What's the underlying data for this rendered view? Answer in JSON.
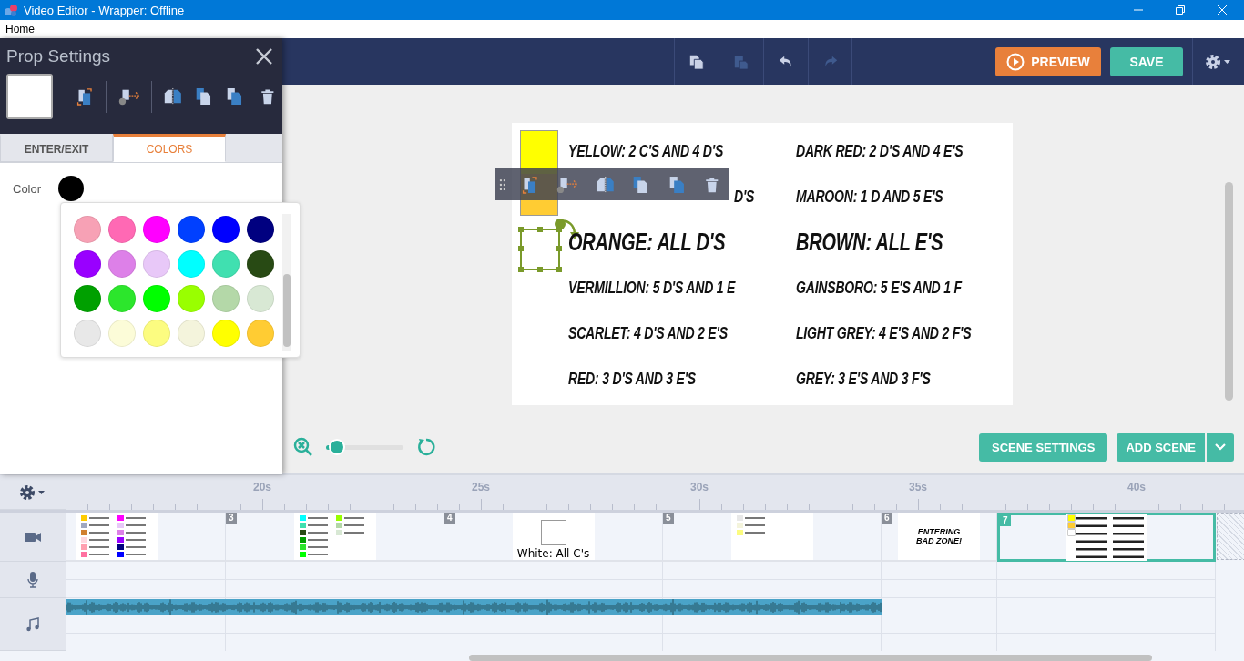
{
  "window": {
    "title": "Video Editor - Wrapper: Offline"
  },
  "menu": [
    "Home"
  ],
  "toolbar": {
    "tools": [
      {
        "kind": "copy",
        "disabled": false
      },
      {
        "kind": "paste",
        "disabled": true
      },
      {
        "kind": "undo",
        "disabled": false
      },
      {
        "kind": "redo",
        "disabled": true
      }
    ],
    "preview": "PREVIEW",
    "save": "SAVE"
  },
  "prop_settings": {
    "title": "Prop Settings",
    "tabs": [
      {
        "label": "ENTER/EXIT",
        "selected": false
      },
      {
        "label": "COLORS",
        "selected": true
      }
    ],
    "color_label": "Color",
    "current": {
      "color": "#000000"
    },
    "palette": [
      {
        "color": "#f7a1b5"
      },
      {
        "color": "#ff69b4"
      },
      {
        "color": "#ff00ff"
      },
      {
        "color": "#0040ff"
      },
      {
        "color": "#0000ff"
      },
      {
        "color": "#000080"
      },
      {
        "color": "#9900ff"
      },
      {
        "color": "#dd80e8"
      },
      {
        "color": "#e8c8f8"
      },
      {
        "color": "#00ffff"
      },
      {
        "color": "#40e0b0"
      },
      {
        "color": "#284a14"
      },
      {
        "color": "#00a000"
      },
      {
        "color": "#2ce62c"
      },
      {
        "color": "#00ff00"
      },
      {
        "color": "#99ff00"
      },
      {
        "color": "#b4d8a8"
      },
      {
        "color": "#d8e8d4"
      },
      {
        "color": "#e8e8e8"
      },
      {
        "color": "#fcfcd8"
      },
      {
        "color": "#fcfc80"
      },
      {
        "color": "#f4f4dc"
      },
      {
        "color": "#ffff00"
      },
      {
        "color": "#ffcc33"
      }
    ]
  },
  "canvas": {
    "swatches": [
      {
        "color": "#ffff00",
        "selected": false
      },
      {
        "color": "#ffcc33",
        "selected": false
      },
      {
        "color": "#ffffff",
        "selected": true
      }
    ],
    "left_texts": [
      "YELLOW: 2 C'S AND 4 D'S",
      "D'S",
      "ORANGE: ALL D'S",
      "VERMILLION: 5 D'S AND 1 E",
      "SCARLET: 4 D'S AND 2 E'S",
      "RED: 3 D'S AND 3 E'S"
    ],
    "right_texts": [
      "DARK RED: 2 D'S AND 4 E'S",
      "MAROON: 1 D AND 5 E'S",
      "BROWN: ALL E'S",
      "GAINSBORO: 5 E'S AND 1 F",
      "LIGHT GREY: 4 E'S AND 2 F'S",
      "GREY: 3 E'S AND 3 F'S"
    ]
  },
  "zoom": {
    "level": 0.14
  },
  "scene_buttons": {
    "settings": "SCENE SETTINGS",
    "add": "ADD SCENE"
  },
  "timeline": {
    "ticks": [
      "20s",
      "25s",
      "30s",
      "35s",
      "40s"
    ],
    "scenes": [
      {
        "kind": "swatches",
        "selected": false,
        "colors": [
          {
            "color": "#ffcc00"
          },
          {
            "color": "#a0a8c0"
          },
          {
            "color": "#d08030"
          },
          {
            "color": "#ffd8e0"
          },
          {
            "color": "#ffa0b0"
          },
          {
            "color": "#ff70a0"
          },
          {
            "color": "#ff00ff"
          },
          {
            "color": "#e8c8f8"
          },
          {
            "color": "#dd80e8"
          },
          {
            "color": "#9900ff"
          },
          {
            "color": "#000080"
          },
          {
            "color": "#0000ff"
          }
        ]
      },
      {
        "kind": "swatches",
        "number": "3",
        "selected": false,
        "colors": [
          {
            "color": "#00ffff"
          },
          {
            "color": "#40e0b0"
          },
          {
            "color": "#284a14"
          },
          {
            "color": "#00a000"
          },
          {
            "color": "#2ce62c"
          },
          {
            "color": "#00ff00"
          },
          {
            "color": "#99ff00"
          },
          {
            "color": "#b4d8a8"
          },
          {
            "color": "#d8e8d4"
          }
        ]
      },
      {
        "kind": "prop",
        "number": "4",
        "selected": false,
        "caption": "White: All C's"
      },
      {
        "kind": "swatches",
        "number": "5",
        "selected": false,
        "colors": [
          {
            "color": "#e8e8e8"
          },
          {
            "color": "#f4f4dc"
          },
          {
            "color": "#fcfc80"
          }
        ]
      },
      {
        "kind": "title",
        "number": "6",
        "selected": false,
        "caption": "ENTERING BAD ZONE!"
      },
      {
        "kind": "grid",
        "number": "7",
        "selected": true,
        "colors": [
          {
            "color": "#ffff00"
          },
          {
            "color": "#ffcc33"
          },
          {
            "color": "#ffffff"
          }
        ]
      }
    ]
  }
}
